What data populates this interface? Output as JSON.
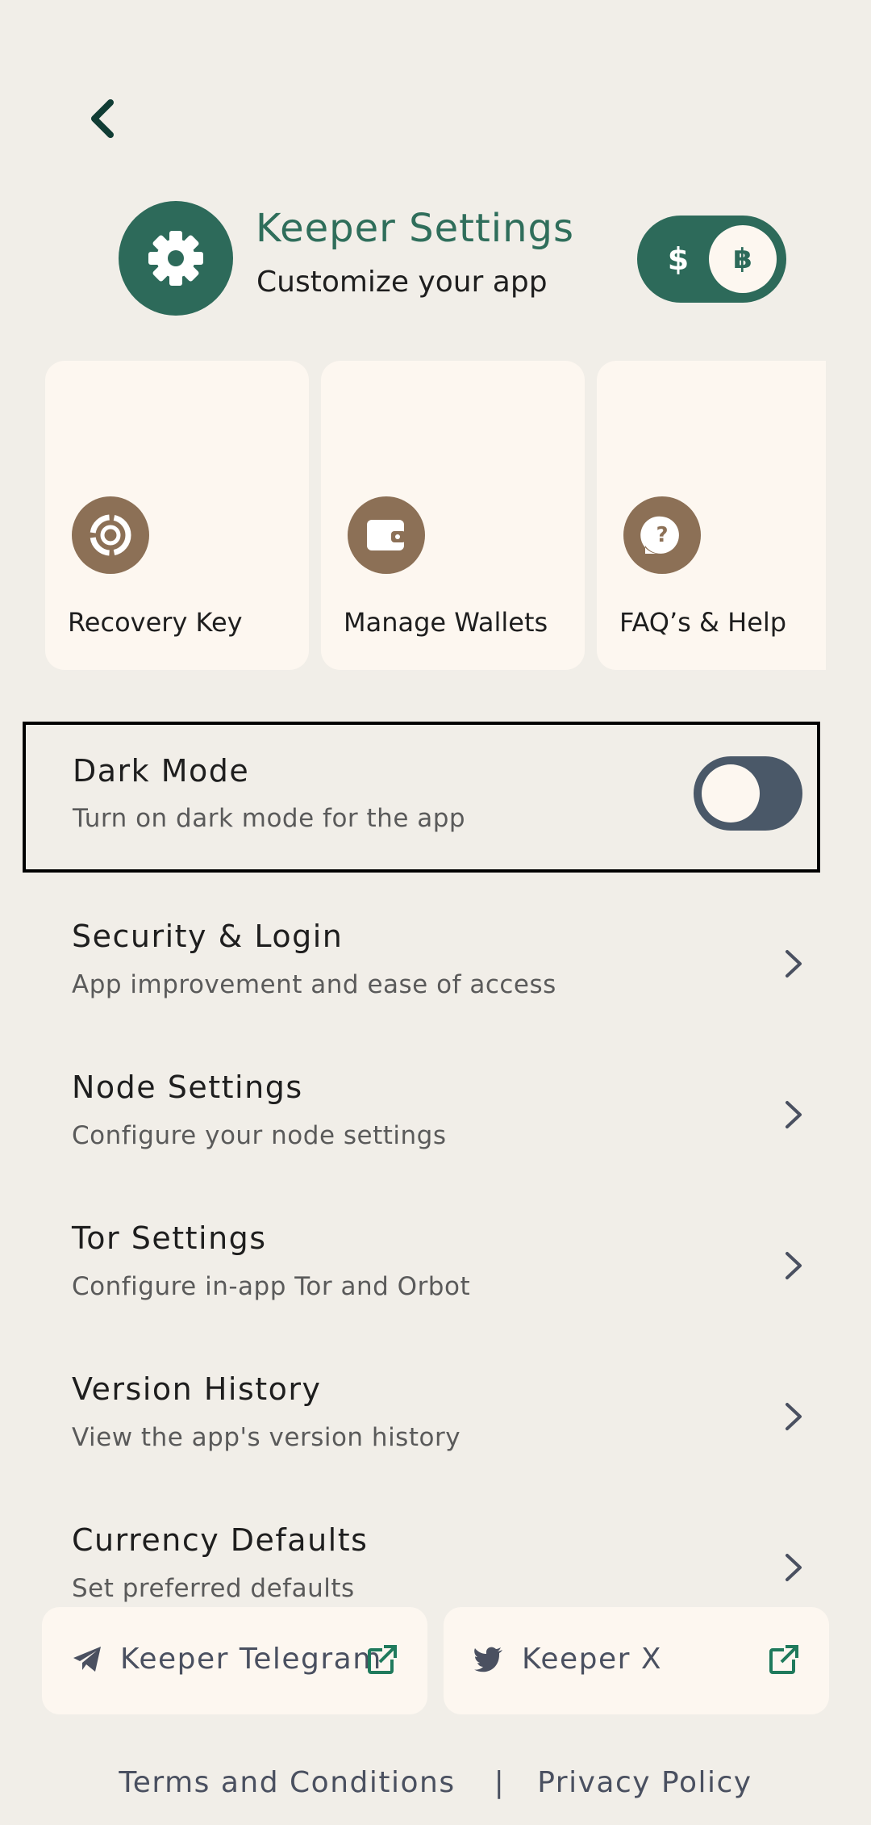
{
  "header": {
    "title": "Keeper Settings",
    "subtitle": "Customize your app",
    "currency_toggle": {
      "left": "$",
      "right": "฿"
    }
  },
  "cards": [
    {
      "label": "Recovery Key",
      "icon": "recovery-key-icon"
    },
    {
      "label": "Manage Wallets",
      "icon": "wallet-icon"
    },
    {
      "label": "FAQ’s & Help",
      "icon": "help-icon"
    }
  ],
  "dark_mode": {
    "title": "Dark Mode",
    "subtitle": "Turn on dark mode for the app",
    "enabled": false
  },
  "menu": [
    {
      "title": "Security & Login",
      "subtitle": "App improvement and ease of access"
    },
    {
      "title": "Node Settings",
      "subtitle": "Configure your node settings"
    },
    {
      "title": "Tor Settings",
      "subtitle": "Configure in-app Tor and Orbot"
    },
    {
      "title": "Version History",
      "subtitle": "View the app's version history"
    },
    {
      "title": "Currency Defaults",
      "subtitle": "Set preferred defaults"
    }
  ],
  "social": {
    "telegram": "Keeper Telegram",
    "x": "Keeper X"
  },
  "footer": {
    "terms": "Terms and Conditions",
    "separator": "|",
    "privacy": "Privacy Policy"
  },
  "colors": {
    "background": "#F1EEE8",
    "card": "#FDF7F0",
    "primary": "#2D6A5A",
    "icon_brown": "#8C7056",
    "toggle_off": "#4A5868"
  }
}
